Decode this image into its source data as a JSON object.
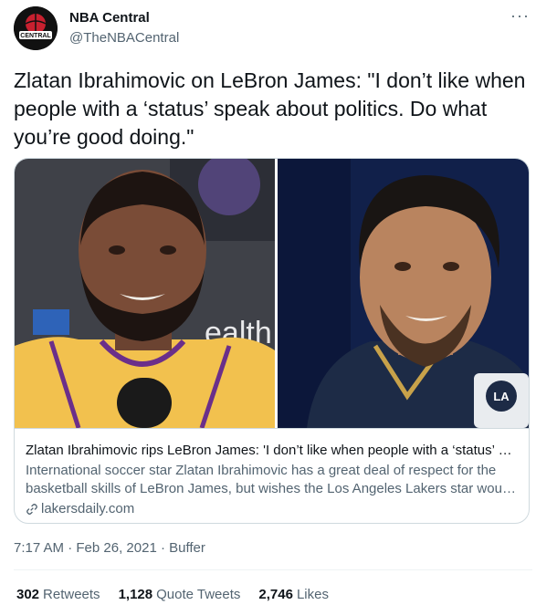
{
  "author": {
    "display_name": "NBA Central",
    "handle": "@TheNBACentral",
    "avatar_text": "CENTRAL"
  },
  "more_label": "···",
  "tweet": {
    "text": "Zlatan Ibrahimovic on LeBron James: \"I don’t like when people with a ‘status’ speak about politics. Do what you’re good doing.\""
  },
  "card": {
    "image_text_health": "ealth",
    "image_text_la": "LA",
    "title": "Zlatan Ibrahimovic rips LeBron James: 'I don’t like when people with a ‘status’ sp...",
    "description": "International soccer star Zlatan Ibrahimovic has a great deal of respect for the basketball skills of LeBron James, but wishes the Los Angeles Lakers star would ...",
    "domain": "lakersdaily.com"
  },
  "meta": {
    "time": "7:17 AM",
    "separator": " · ",
    "date": "Feb 26, 2021",
    "source": "Buffer"
  },
  "stats": [
    {
      "count": "302",
      "label": "Retweets"
    },
    {
      "count": "1,128",
      "label": "Quote Tweets"
    },
    {
      "count": "2,746",
      "label": "Likes"
    }
  ],
  "colors": {
    "text_primary": "#0f1419",
    "text_secondary": "#536471",
    "border": "#cfd9de",
    "lakers_gold": "#f2c14e",
    "galaxy_navy": "#1d2b46"
  }
}
